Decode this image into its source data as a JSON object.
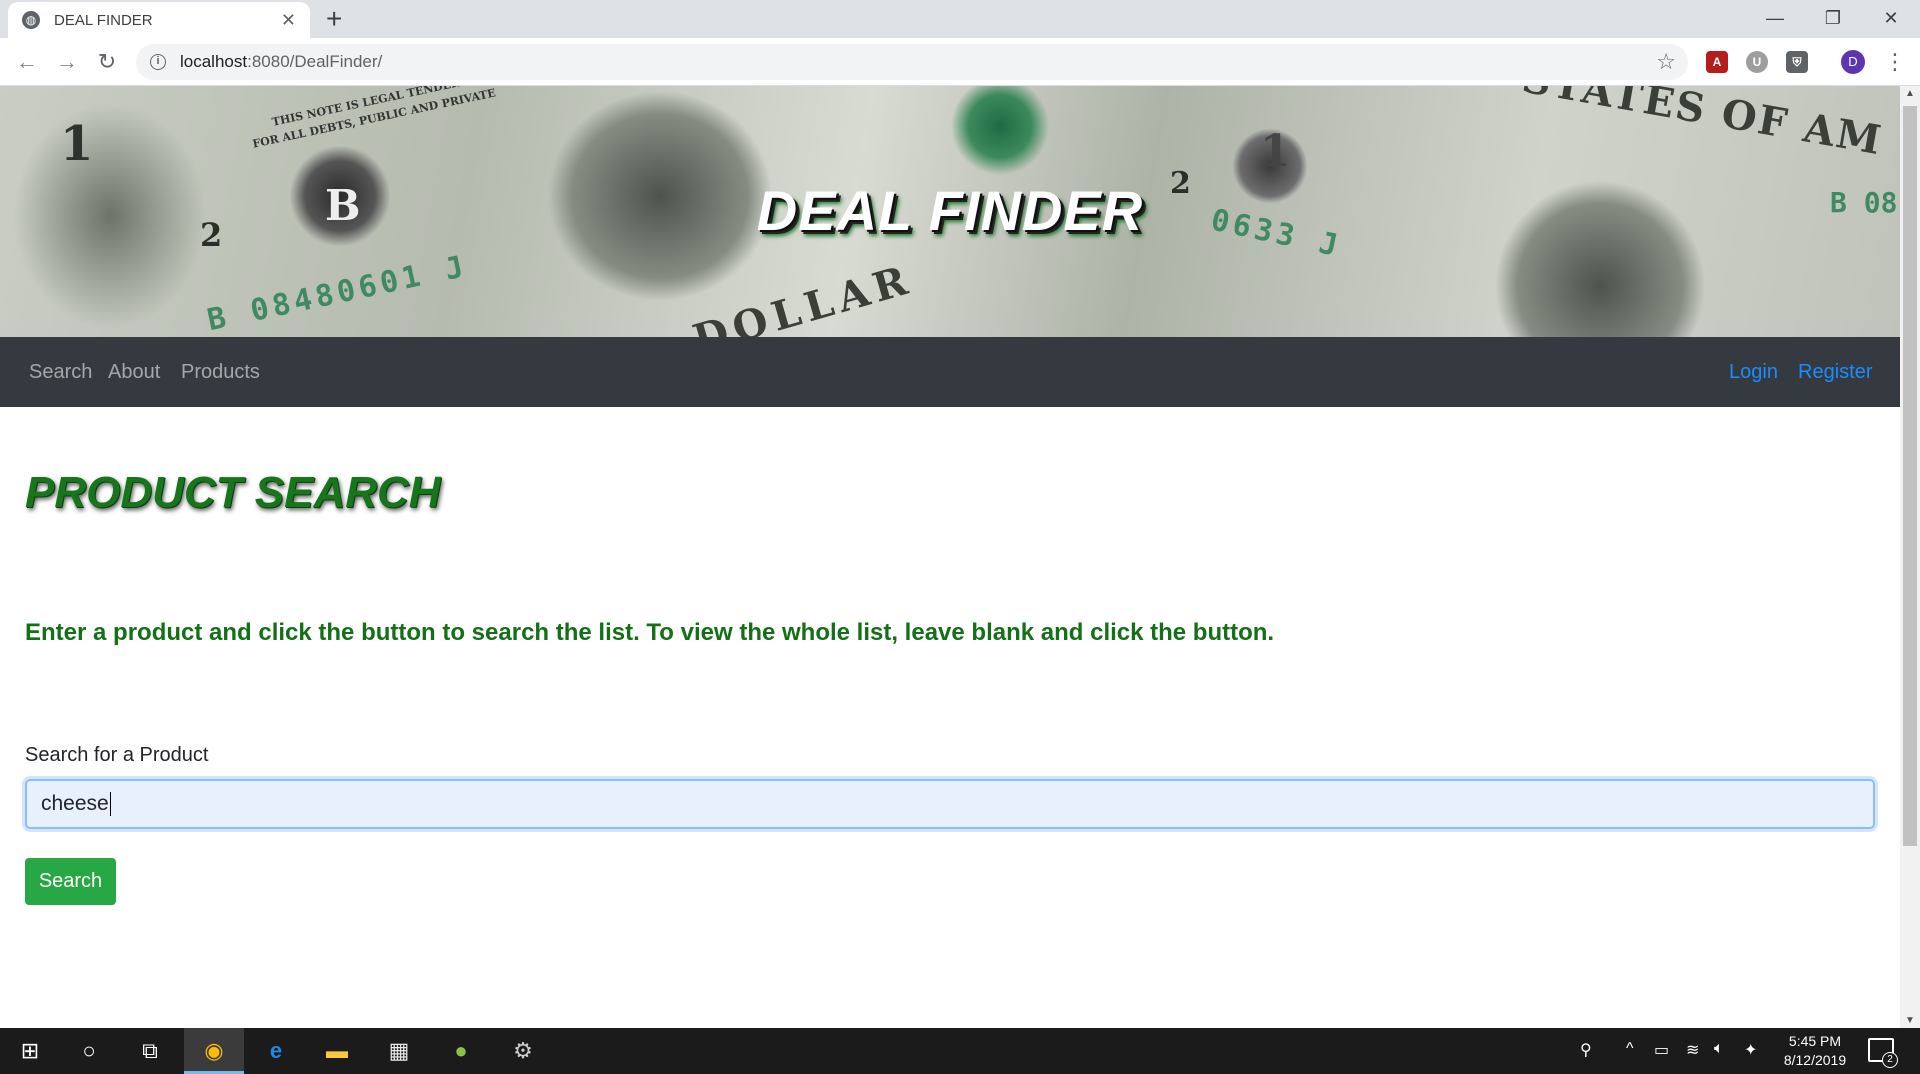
{
  "browser": {
    "tab_title": "DEAL FINDER",
    "url_host": "localhost",
    "url_path": ":8080/DealFinder/",
    "avatar_initial": "D",
    "icons": [
      "back-icon",
      "forward-icon",
      "reload-icon",
      "info-icon",
      "star-icon",
      "menu-icon"
    ]
  },
  "banner": {
    "title": "DEAL FINDER",
    "note_text_1": "THIS NOTE IS LEGAL TENDER",
    "note_text_2": "FOR ALL DEBTS, PUBLIC AND PRIVATE",
    "serial_left": "B 08480601 J",
    "serial_right": "0633 J",
    "serial_far_right": "B 08",
    "denomination_1": "1",
    "denomination_2": "2",
    "letter": "B",
    "states_text": "STATES OF AM",
    "dollar_text": "DOLLAR"
  },
  "navbar": {
    "left_links": [
      "Search",
      "About",
      "Products"
    ],
    "right_links": [
      "Login",
      "Register"
    ]
  },
  "main": {
    "heading": "PRODUCT SEARCH",
    "instructions": "Enter a product and click the button to search the list. To view the whole list, leave blank and click the button.",
    "field_label": "Search for a Product",
    "search_value": "cheese",
    "button_label": "Search"
  },
  "taskbar": {
    "time": "5:45 PM",
    "date": "8/12/2019",
    "notification_count": "2"
  },
  "colors": {
    "navbar_bg": "#343a40",
    "accent_green": "#28a745",
    "heading_green": "#17751c",
    "link_blue": "#1a8cff"
  }
}
